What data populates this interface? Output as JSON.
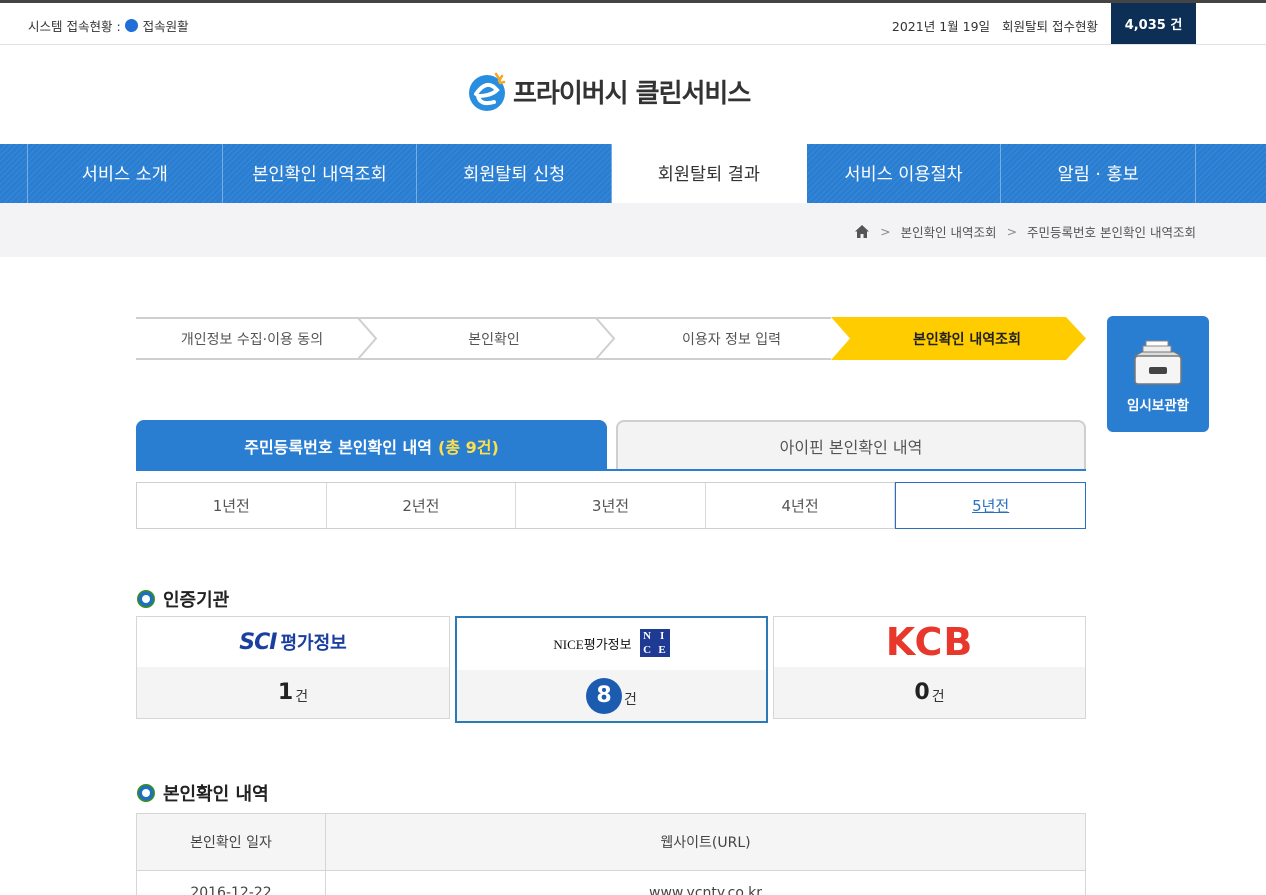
{
  "topbar": {
    "status_label": "시스템 접속현황 :",
    "status_value": "접속원활",
    "date": "2021년 1월 19일",
    "counter_label": "회원탈퇴 접수현황",
    "counter_value": "4,035 건"
  },
  "logo": {
    "title": "프라이버시 클린서비스"
  },
  "nav": {
    "items": [
      {
        "label": "서비스 소개"
      },
      {
        "label": "본인확인 내역조회"
      },
      {
        "label": "회원탈퇴 신청"
      },
      {
        "label": "회원탈퇴 결과"
      },
      {
        "label": "서비스 이용절차"
      },
      {
        "label": "알림 · 홍보"
      }
    ],
    "active_index": 3
  },
  "breadcrumb": {
    "items": [
      "본인확인 내역조회",
      "주민등록번호 본인확인 내역조회"
    ]
  },
  "steps": {
    "items": [
      "개인정보 수집·이용 동의",
      "본인확인",
      "이용자 정보 입력",
      "본인확인 내역조회"
    ],
    "active_index": 3
  },
  "locker": {
    "label": "임시보관함"
  },
  "tabs": {
    "resident": {
      "label": "주민등록번호 본인확인 내역",
      "count": "(총 9건)"
    },
    "ipin": {
      "label": "아이핀 본인확인 내역"
    }
  },
  "years": {
    "items": [
      "1년전",
      "2년전",
      "3년전",
      "4년전",
      "5년전"
    ],
    "active_index": 4
  },
  "agencies": {
    "title": "인증기관",
    "unit": "건",
    "items": [
      {
        "logo_text": "SCI",
        "logo_sub": "평가정보",
        "count": "1"
      },
      {
        "logo_text": "NICE평가정보",
        "logo_letters": [
          "N",
          "I",
          "C",
          "E"
        ],
        "count": "8"
      },
      {
        "logo_text": "KCB",
        "count": "0"
      }
    ],
    "active_index": 1
  },
  "history": {
    "title": "본인확인 내역",
    "headers": [
      "본인확인 일자",
      "웹사이트(URL)"
    ],
    "rows": [
      [
        "2016-12-22",
        "www.ycnty.co.kr"
      ]
    ]
  },
  "colors": {
    "nav_blue": "#2a7ed2",
    "counter_navy": "#0e2f55",
    "step_active": "#ffcc00",
    "highlight_yellow": "#ffe04a",
    "nice_navy": "#1f3a93",
    "kcb_red": "#e8382b",
    "section_green": "#3a8e1e"
  }
}
